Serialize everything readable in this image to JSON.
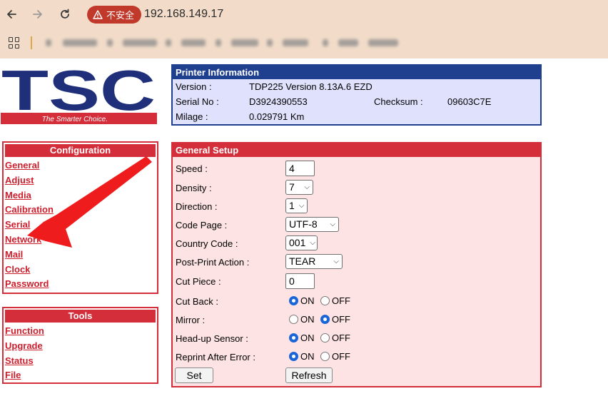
{
  "browser": {
    "security_label": "不安全",
    "url": "192.168.149.17"
  },
  "logo": {
    "text": "TSC",
    "tagline": "The Smarter Choice."
  },
  "config": {
    "title": "Configuration",
    "items": [
      "General",
      "Adjust",
      "Media",
      "Calibration",
      "Serial",
      "Network",
      "Mail",
      "Clock",
      "Password"
    ]
  },
  "tools": {
    "title": "Tools",
    "items": [
      "Function",
      "Upgrade",
      "Status",
      "File"
    ]
  },
  "printer_info": {
    "title": "Printer Information",
    "version_label": "Version :",
    "version_value": "TDP225 Version 8.13A.6 EZD",
    "serial_label": "Serial No :",
    "serial_value": "D3924390553",
    "checksum_label": "Checksum :",
    "checksum_value": "09603C7E",
    "milage_label": "Milage :",
    "milage_value": "0.029791 Km"
  },
  "setup": {
    "title": "General Setup",
    "speed_label": "Speed :",
    "speed_value": "4",
    "density_label": "Density :",
    "density_value": "7",
    "direction_label": "Direction :",
    "direction_value": "1",
    "codepage_label": "Code Page :",
    "codepage_value": "UTF-8",
    "country_label": "Country Code :",
    "country_value": "001",
    "postprint_label": "Post-Print Action :",
    "postprint_value": "TEAR",
    "cutpiece_label": "Cut Piece :",
    "cutpiece_value": "0",
    "cutback_label": "Cut Back :",
    "mirror_label": "Mirror :",
    "headup_label": "Head-up Sensor :",
    "reprint_label": "Reprint After Error :",
    "on_label": "ON",
    "off_label": "OFF",
    "cutback_selected": "ON",
    "mirror_selected": "OFF",
    "headup_selected": "ON",
    "reprint_selected": "ON",
    "set_button": "Set",
    "refresh_button": "Refresh"
  },
  "colors": {
    "brand_red": "#d42e3a",
    "brand_blue": "#1f3f8f",
    "security_red": "#c0392b"
  }
}
